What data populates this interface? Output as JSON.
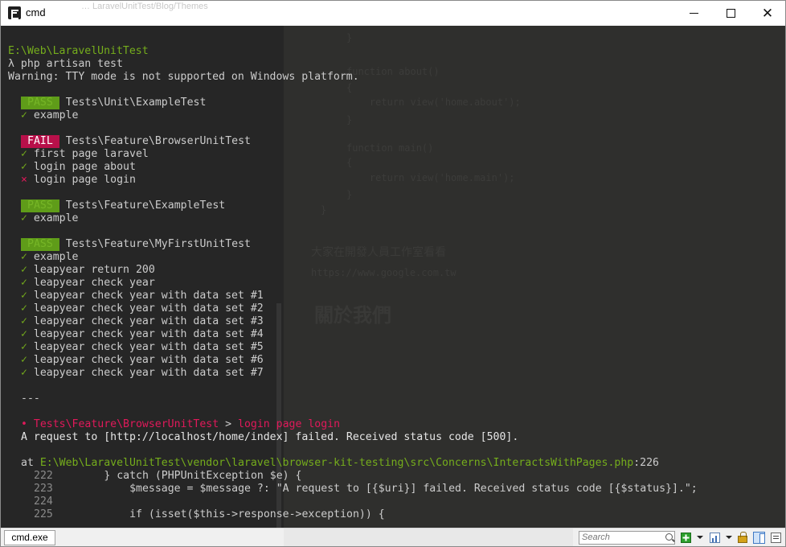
{
  "window": {
    "title": "cmd",
    "ghost_title": "… LaravelUnitTest/Blog/Themes"
  },
  "terminal": {
    "path": "E:\\Web\\LaravelUnitTest",
    "prompt": "λ php artisan test",
    "warning": "Warning: TTY mode is not supported on Windows platform.",
    "pass_label": "PASS",
    "fail_label": "FAIL",
    "check": "✓",
    "cross": "⨯",
    "suites": [
      {
        "status": "PASS",
        "name": "Tests\\Unit\\ExampleTest",
        "tests": [
          {
            "ok": true,
            "name": "example"
          }
        ]
      },
      {
        "status": "FAIL",
        "name": "Tests\\Feature\\BrowserUnitTest",
        "tests": [
          {
            "ok": true,
            "name": "first page laravel"
          },
          {
            "ok": true,
            "name": "login page about"
          },
          {
            "ok": false,
            "name": "login page login"
          }
        ]
      },
      {
        "status": "PASS",
        "name": "Tests\\Feature\\ExampleTest",
        "tests": [
          {
            "ok": true,
            "name": "example"
          }
        ]
      },
      {
        "status": "PASS",
        "name": "Tests\\Feature\\MyFirstUnitTest",
        "tests": [
          {
            "ok": true,
            "name": "example"
          },
          {
            "ok": true,
            "name": "leapyear return 200"
          },
          {
            "ok": true,
            "name": "leapyear check year"
          },
          {
            "ok": true,
            "name": "leapyear check year with data set #1"
          },
          {
            "ok": true,
            "name": "leapyear check year with data set #2"
          },
          {
            "ok": true,
            "name": "leapyear check year with data set #3"
          },
          {
            "ok": true,
            "name": "leapyear check year with data set #4"
          },
          {
            "ok": true,
            "name": "leapyear check year with data set #5"
          },
          {
            "ok": true,
            "name": "leapyear check year with data set #6"
          },
          {
            "ok": true,
            "name": "leapyear check year with data set #7"
          }
        ]
      }
    ],
    "separator": "---",
    "failure_bullet": "•",
    "failure_test": "Tests\\Feature\\BrowserUnitTest",
    "failure_arrow": ">",
    "failure_case": "login page login",
    "failure_message": "A request to [http://localhost/home/index] failed. Received status code [500].",
    "at_label": "at",
    "at_path": "E:\\Web\\LaravelUnitTest\\vendor\\laravel\\browser-kit-testing\\src\\Concerns\\InteractsWithPages.php",
    "at_line": ":226",
    "code_lines": [
      {
        "no": "222",
        "code": "        } catch (PHPUnitException $e) {"
      },
      {
        "no": "223",
        "code": "            $message = $message ?: \"A request to [{$uri}] failed. Received status code [{$status}].\";"
      },
      {
        "no": "224",
        "code": ""
      },
      {
        "no": "225",
        "code": "            if (isset($this->response->exception)) {"
      }
    ]
  },
  "background_ghost": {
    "lines": [
      "}",
      "function about()",
      "{",
      "    return view('home.about');",
      "}",
      "function main()",
      "{",
      "    return view('home.main');",
      "}",
      "}"
    ],
    "text1": "大家在開發人員工作室看看",
    "text2": "https://www.google.com.tw",
    "heading": "關於我們"
  },
  "bottombar": {
    "tab_label": "cmd.exe",
    "search_placeholder": "Search"
  },
  "icons": [
    "app-icon",
    "minimize-icon",
    "maximize-icon",
    "close-icon",
    "search-icon",
    "plus-icon",
    "chevron-down-icon",
    "chart-icon",
    "lock-icon",
    "panel-icon",
    "list-icon"
  ]
}
